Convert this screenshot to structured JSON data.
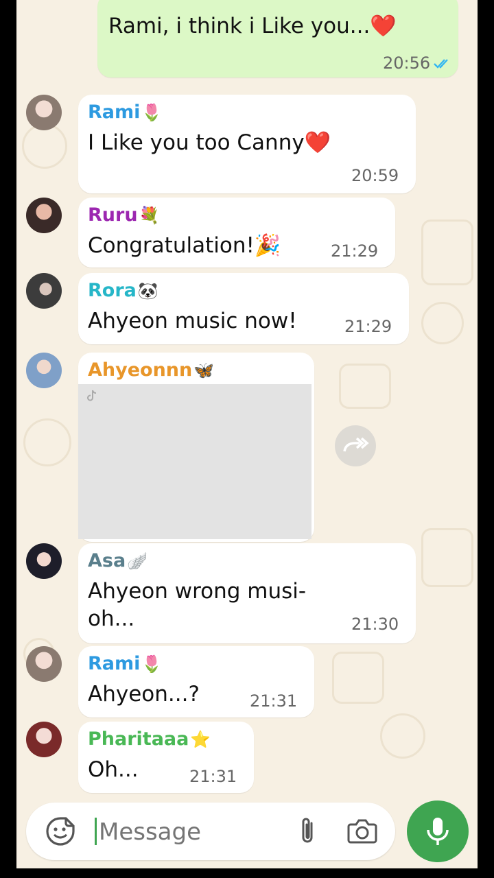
{
  "outgoing": {
    "text": "Rami, i think i Like you...❤️",
    "time": "20:56",
    "status_icon": "double-check-icon"
  },
  "messages": [
    {
      "sender": "Rami",
      "emoji": "🌷",
      "text": "I Like you too Canny❤️",
      "time": "20:59"
    },
    {
      "sender": "Ruru",
      "emoji": "💐",
      "text": "Congratulation!🎉",
      "time": "21:29"
    },
    {
      "sender": "Rora",
      "emoji": "🐼",
      "text": "Ahyeon music now!",
      "time": "21:29"
    },
    {
      "sender": "Ahyeonnn",
      "emoji": "🦋",
      "media": "tiktok-video"
    },
    {
      "sender": "Asa",
      "emoji": "🪽",
      "text_line1": "Ahyeon wrong musi-",
      "text_line2": "oh...",
      "time": "21:30"
    },
    {
      "sender": "Rami",
      "emoji": "🌷",
      "text": "Ahyeon...?",
      "time": "21:31"
    },
    {
      "sender": "Pharitaaa",
      "emoji": "⭐",
      "text": "Oh...",
      "time": "21:31"
    }
  ],
  "composer": {
    "placeholder": "Message"
  },
  "colors": {
    "rami": "#2d9ae0",
    "ruru": "#9c27b0",
    "rora": "#26b6c8",
    "ahyeonnn": "#e8962a",
    "asa": "#5a7f8c",
    "pharitaaa": "#49b855",
    "accent_green": "#3fa551",
    "outgoing_bubble": "#dcf8c6",
    "read_ticks": "#34b7f1"
  }
}
